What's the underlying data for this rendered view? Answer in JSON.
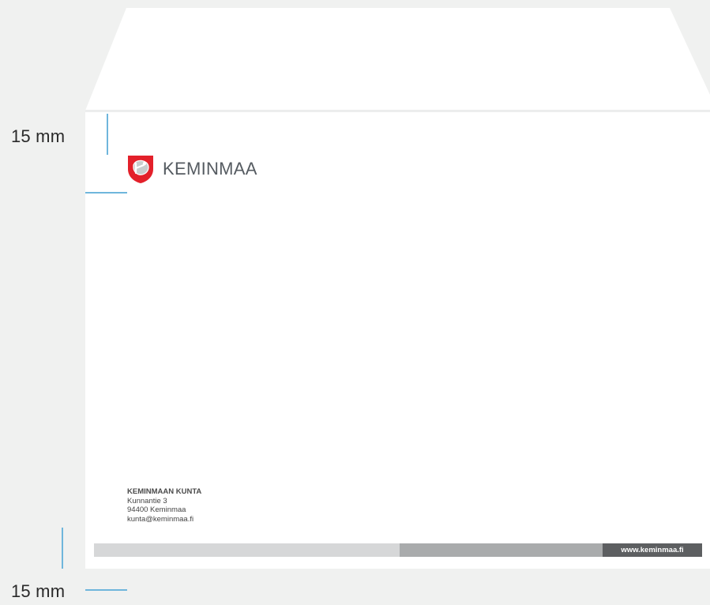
{
  "dimensions": {
    "top_margin_label": "15 mm",
    "bottom_margin_label": "15 mm"
  },
  "logo": {
    "wordmark": "KEMINMAA",
    "icon": "coat-of-arms-icon"
  },
  "address": {
    "organization": "KEMINMAAN KUNTA",
    "street": "Kunnantie 3",
    "postal": "94400 Keminmaa",
    "email": "kunta@keminmaa.fi"
  },
  "footer": {
    "website": "www.keminmaa.fi"
  },
  "colors": {
    "background": "#f0f1f0",
    "guide": "#6fb6dc",
    "shield_red": "#e3202a",
    "bar_light": "#d6d7d8",
    "bar_mid": "#a9abac",
    "bar_dark": "#5d5f61"
  }
}
